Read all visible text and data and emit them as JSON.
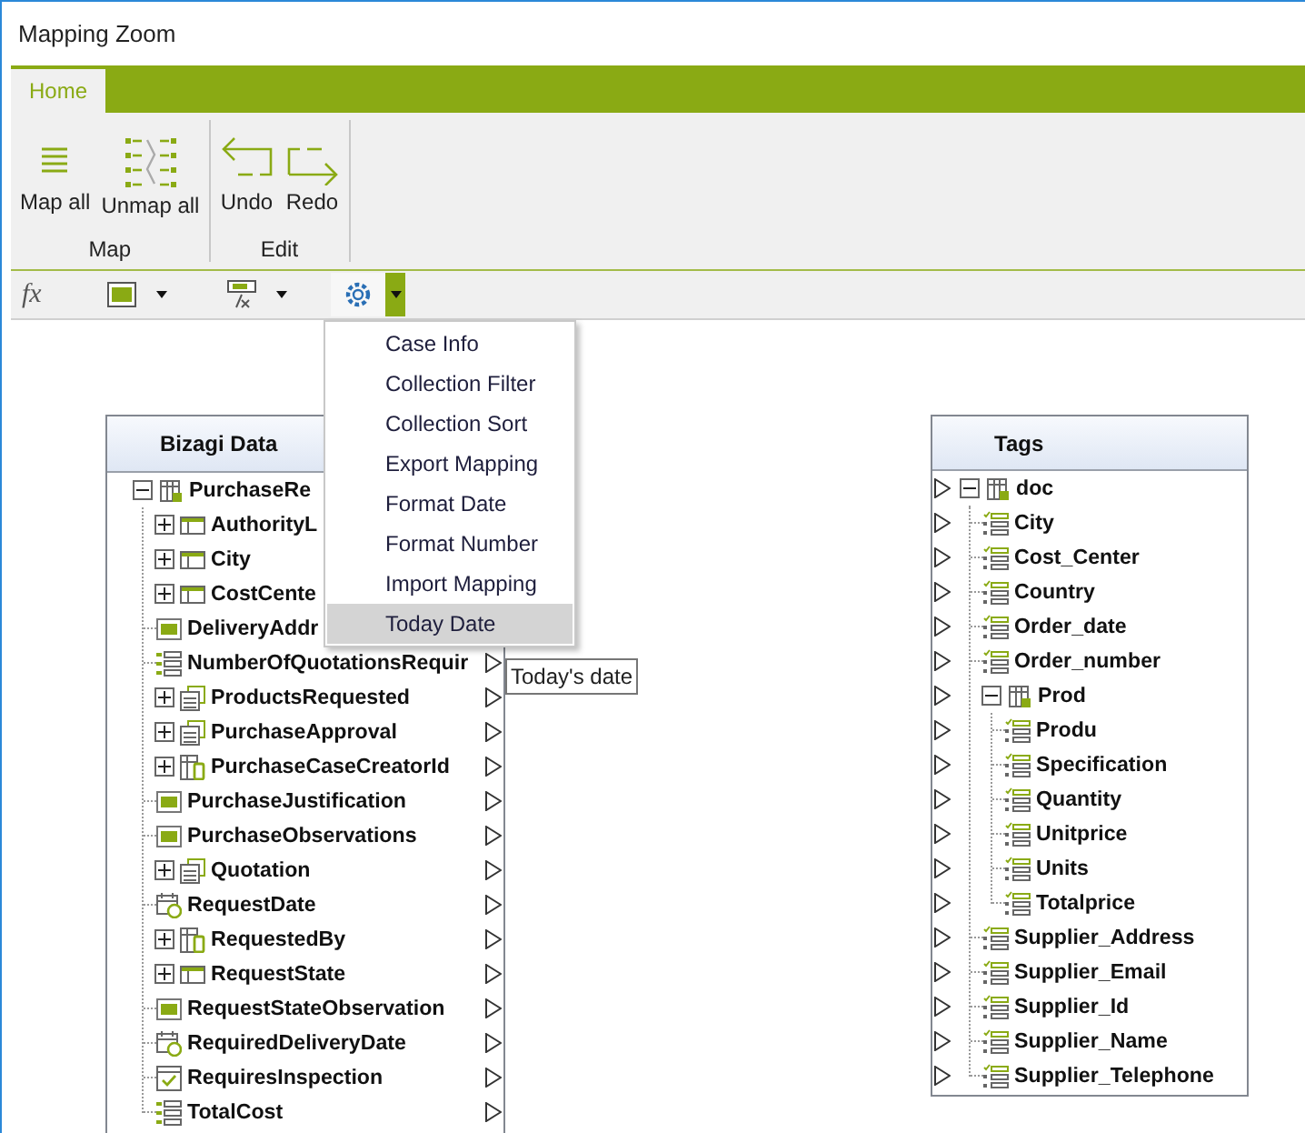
{
  "window": {
    "title": "Mapping Zoom"
  },
  "ribbon": {
    "tabs": [
      {
        "label": "Home",
        "selected": true
      }
    ],
    "groups": [
      {
        "label": "Map",
        "buttons": [
          {
            "label": "Map all",
            "kind": "map_all"
          },
          {
            "label": "Unmap all",
            "kind": "unmap_all"
          }
        ]
      },
      {
        "label": "Edit",
        "buttons": [
          {
            "label": "Undo",
            "kind": "undo"
          },
          {
            "label": "Redo",
            "kind": "redo"
          }
        ]
      }
    ]
  },
  "toolbar": {
    "items": [
      {
        "kind": "formula",
        "label": "fx"
      },
      {
        "kind": "text",
        "active": false
      },
      {
        "kind": "function",
        "active": false
      },
      {
        "kind": "gear",
        "active": true
      }
    ]
  },
  "source_panel": {
    "title": "Bizagi Data",
    "tree": [
      {
        "label": "PurchaseRe",
        "kind": "entity",
        "expanded": true,
        "connector": false,
        "children": [
          {
            "label": "AuthorityL",
            "kind": "table",
            "expanded": false,
            "connector": false
          },
          {
            "label": "City",
            "kind": "table",
            "expanded": false,
            "connector": false
          },
          {
            "label": "CostCente",
            "kind": "table",
            "expanded": false,
            "connector": false
          },
          {
            "label": "DeliveryAddr",
            "kind": "text",
            "connector": false
          },
          {
            "label": "NumberOfQuotationsRequir",
            "kind": "number",
            "connector": true
          },
          {
            "label": "ProductsRequested",
            "kind": "collection",
            "expanded": false,
            "connector": true
          },
          {
            "label": "PurchaseApproval",
            "kind": "collection",
            "expanded": false,
            "connector": true
          },
          {
            "label": "PurchaseCaseCreatorId",
            "kind": "user",
            "expanded": false,
            "connector": true
          },
          {
            "label": "PurchaseJustification",
            "kind": "text",
            "connector": true
          },
          {
            "label": "PurchaseObservations",
            "kind": "text",
            "connector": true
          },
          {
            "label": "Quotation",
            "kind": "collection",
            "expanded": false,
            "connector": true
          },
          {
            "label": "RequestDate",
            "kind": "date",
            "connector": true
          },
          {
            "label": "RequestedBy",
            "kind": "user",
            "expanded": false,
            "connector": true
          },
          {
            "label": "RequestState",
            "kind": "table",
            "expanded": false,
            "connector": true
          },
          {
            "label": "RequestStateObservation",
            "kind": "text",
            "connector": true
          },
          {
            "label": "RequiredDeliveryDate",
            "kind": "date",
            "connector": true
          },
          {
            "label": "RequiresInspection",
            "kind": "boolean",
            "connector": true
          },
          {
            "label": "TotalCost",
            "kind": "number",
            "connector": true
          }
        ]
      }
    ]
  },
  "target_panel": {
    "title": "Tags",
    "tree": [
      {
        "label": "doc",
        "kind": "entity",
        "expanded": true,
        "children": [
          {
            "label": "City",
            "kind": "element"
          },
          {
            "label": "Cost_Center",
            "kind": "element"
          },
          {
            "label": "Country",
            "kind": "element"
          },
          {
            "label": "Order_date",
            "kind": "element"
          },
          {
            "label": "Order_number",
            "kind": "element"
          },
          {
            "label": "Prod",
            "kind": "entity",
            "expanded": true,
            "children": [
              {
                "label": "Produ",
                "kind": "element"
              },
              {
                "label": "Specification",
                "kind": "element"
              },
              {
                "label": "Quantity",
                "kind": "element"
              },
              {
                "label": "Unitprice",
                "kind": "element"
              },
              {
                "label": "Units",
                "kind": "element"
              },
              {
                "label": "Totalprice",
                "kind": "element"
              }
            ]
          },
          {
            "label": "Supplier_Address",
            "kind": "element"
          },
          {
            "label": "Supplier_Email",
            "kind": "element"
          },
          {
            "label": "Supplier_Id",
            "kind": "element"
          },
          {
            "label": "Supplier_Name",
            "kind": "element"
          },
          {
            "label": "Supplier_Telephone",
            "kind": "element"
          }
        ]
      }
    ]
  },
  "menu": {
    "items": [
      {
        "label": "Case Info",
        "selected": false
      },
      {
        "label": "Collection Filter",
        "selected": false
      },
      {
        "label": "Collection Sort",
        "selected": false
      },
      {
        "label": "Export Mapping",
        "selected": false
      },
      {
        "label": "Format Date",
        "selected": false
      },
      {
        "label": "Format Number",
        "selected": false
      },
      {
        "label": "Import Mapping",
        "selected": false
      },
      {
        "label": "Today Date",
        "selected": true
      }
    ]
  },
  "tooltip": {
    "text": "Today's date"
  }
}
